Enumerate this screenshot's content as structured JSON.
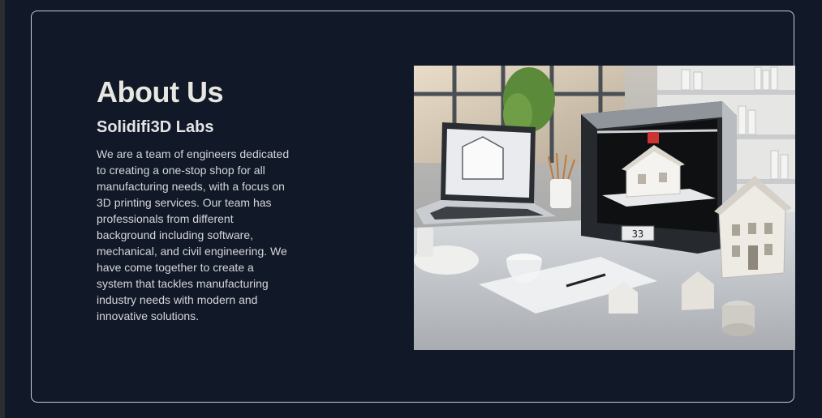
{
  "about": {
    "title": "About Us",
    "subtitle": "Solidifi3D Labs",
    "description": "We are a team of engineers dedicated to creating a one-stop shop for all manufacturing needs, with a focus on 3D printing services. Our team has professionals from different background including software, mechanical, and civil engineering. We have come together to create a system that tackles manufacturing industry needs with modern and innovative solutions."
  },
  "hero_image": {
    "subject": "3D printer printing a house model on a desk",
    "printer_display": "33"
  },
  "colors": {
    "page_background": "#111827",
    "card_border": "#c9ccd3",
    "heading": "#e8e6e1",
    "body_text": "#d4d6db"
  }
}
